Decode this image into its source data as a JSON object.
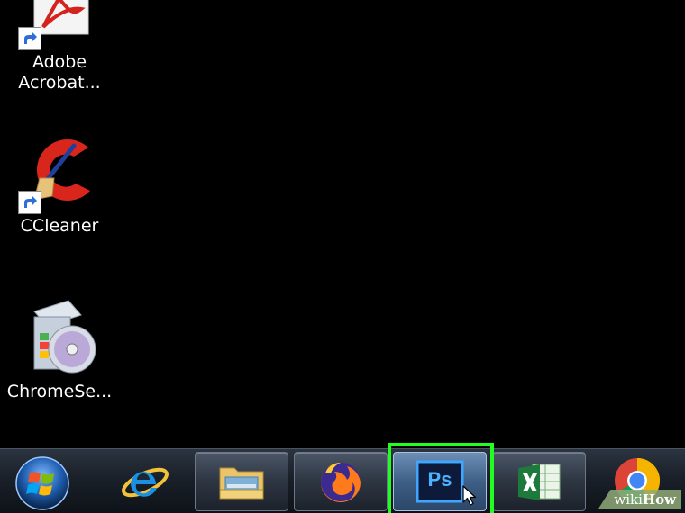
{
  "desktop": {
    "icons": [
      {
        "label": "Adobe",
        "label2": "Acrobat...",
        "icon": "adobe-acrobat-icon"
      },
      {
        "label": "CCleaner",
        "icon": "ccleaner-icon"
      },
      {
        "label": "ChromeSe...",
        "icon": "chrome-setup-icon"
      }
    ]
  },
  "taskbar": {
    "start_icon": "windows-start-orb-icon",
    "buttons": [
      {
        "icon": "internet-explorer-icon"
      },
      {
        "icon": "file-explorer-icon"
      },
      {
        "icon": "firefox-icon"
      },
      {
        "icon": "photoshop-icon",
        "text": "Ps",
        "active": true
      },
      {
        "icon": "excel-icon"
      },
      {
        "icon": "chrome-icon"
      }
    ]
  },
  "colors": {
    "highlight": "#21ff21",
    "desktop_bg": "#000000"
  },
  "watermark": {
    "part1": "wiki",
    "part2": "How"
  }
}
